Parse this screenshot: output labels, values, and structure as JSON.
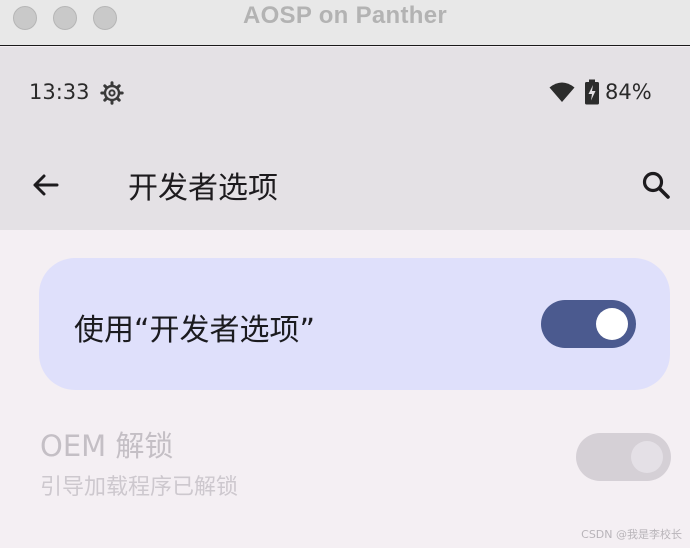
{
  "window": {
    "title": "AOSP on Panther"
  },
  "status_bar": {
    "time": "13:33",
    "battery": "84%",
    "icons": [
      "settings-gear-icon",
      "wifi-icon",
      "battery-charging-icon"
    ]
  },
  "app_bar": {
    "title": "开发者选项",
    "back_icon": "arrow-back-icon",
    "search_icon": "search-icon"
  },
  "main_toggle": {
    "label": "使用“开发者选项”",
    "state": "on",
    "accent": "#4b5a8f",
    "card_color": "#dfe0fb"
  },
  "oem_unlock": {
    "title": "OEM 解锁",
    "summary": "引导加载程序已解锁",
    "state": "off",
    "enabled": false
  },
  "watermark": "CSDN @我是李校长"
}
